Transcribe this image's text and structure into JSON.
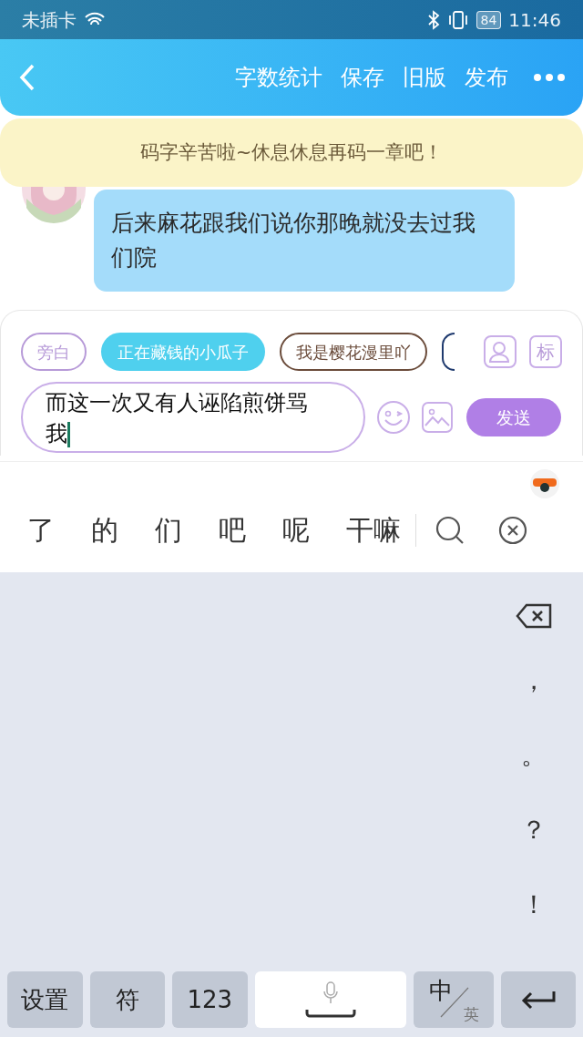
{
  "status_bar": {
    "carrier": "未插卡",
    "battery": "84",
    "time": "11:46"
  },
  "header": {
    "actions": [
      "字数统计",
      "保存",
      "旧版",
      "发布"
    ]
  },
  "banner": {
    "text": "码字辛苦啦~休息休息再码一章吧！"
  },
  "messages": [
    {
      "text": "后来麻花跟我们说你那晚就没去过我们院"
    }
  ],
  "roles": [
    {
      "name": "旁白",
      "color": "#b79ad8",
      "selected": false
    },
    {
      "name": "正在藏钱的小瓜子",
      "color": "#4fd0ee",
      "selected": true
    },
    {
      "name": "我是樱花漫里吖",
      "color": "#6b4c3b",
      "selected": false
    },
    {
      "color": "#1f3a6e",
      "selected": false
    }
  ],
  "tools": [
    "标"
  ],
  "composer": {
    "value": "而这一次又有人诬陷煎饼骂我",
    "send": "发送"
  },
  "candidates": [
    "了",
    "的",
    "们",
    "吧",
    "呢",
    "干嘛"
  ],
  "punctuation": [
    "，",
    "。",
    "？",
    "！"
  ],
  "bottom_keys": [
    {
      "kind": "text",
      "label": "设置"
    },
    {
      "kind": "text",
      "label": "符"
    },
    {
      "kind": "text",
      "label": "123"
    },
    {
      "kind": "space"
    },
    {
      "kind": "lang",
      "label": "中",
      "sub": "英"
    },
    {
      "kind": "enter"
    }
  ]
}
